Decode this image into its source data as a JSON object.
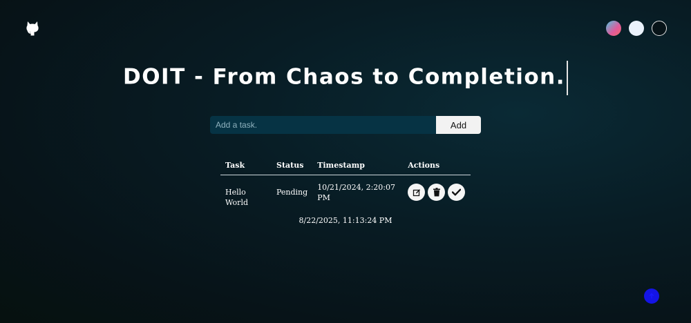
{
  "header": {
    "github_icon": "github-icon",
    "theme_options": [
      "gradient",
      "light",
      "dark"
    ],
    "theme_colors": {
      "gradient": "#e05a9b",
      "light": "#eaf2fb",
      "dark": "#071318"
    }
  },
  "title": "DOIT - From Chaos to Completion.",
  "add_form": {
    "placeholder": "Add a task.",
    "value": "",
    "button_label": "Add"
  },
  "table": {
    "headers": [
      "Task",
      "Status",
      "Timestamp",
      "Actions"
    ],
    "rows": [
      {
        "task": "Hello World",
        "status": "Pending",
        "timestamp": "10/21/2024, 2:20:07 PM",
        "actions": [
          "edit-icon",
          "trash-icon",
          "check-icon"
        ]
      }
    ]
  },
  "clock": "8/22/2025, 11:13:24 PM",
  "fab": {
    "icon": "arrow-up-icon",
    "color": "#1414e6"
  }
}
